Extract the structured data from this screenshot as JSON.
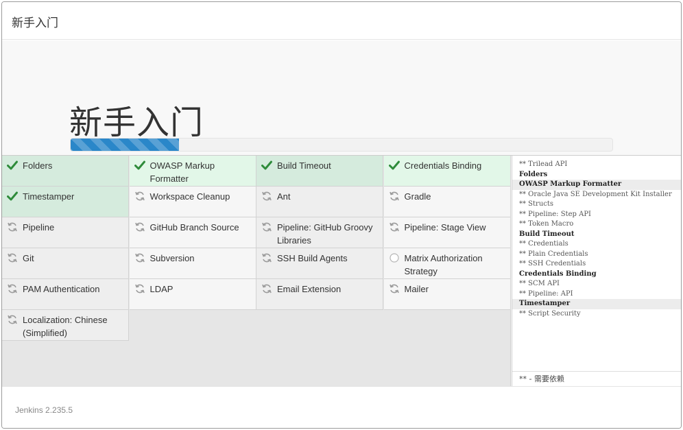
{
  "header": {
    "title": "新手入门"
  },
  "jumbotron": {
    "title": "新手入门",
    "progress_fraction": 0.2
  },
  "plugins": [
    {
      "name": "Folders",
      "status": "success"
    },
    {
      "name": "OWASP Markup Formatter",
      "status": "success"
    },
    {
      "name": "Build Timeout",
      "status": "success"
    },
    {
      "name": "Credentials Binding",
      "status": "success"
    },
    {
      "name": "Timestamper",
      "status": "success"
    },
    {
      "name": "Workspace Cleanup",
      "status": "pending"
    },
    {
      "name": "Ant",
      "status": "pending"
    },
    {
      "name": "Gradle",
      "status": "pending"
    },
    {
      "name": "Pipeline",
      "status": "pending"
    },
    {
      "name": "GitHub Branch Source",
      "status": "pending"
    },
    {
      "name": "Pipeline: GitHub Groovy Libraries",
      "status": "pending"
    },
    {
      "name": "Pipeline: Stage View",
      "status": "pending"
    },
    {
      "name": "Git",
      "status": "pending"
    },
    {
      "name": "Subversion",
      "status": "pending"
    },
    {
      "name": "SSH Build Agents",
      "status": "pending"
    },
    {
      "name": "Matrix Authorization Strategy",
      "status": "queued"
    },
    {
      "name": "PAM Authentication",
      "status": "pending"
    },
    {
      "name": "LDAP",
      "status": "pending"
    },
    {
      "name": "Email Extension",
      "status": "pending"
    },
    {
      "name": "Mailer",
      "status": "pending"
    },
    {
      "name": "Localization: Chinese (Simplified)",
      "status": "pending"
    }
  ],
  "log": {
    "lines": [
      {
        "text": "** Trilead API",
        "kind": "dep"
      },
      {
        "text": "Folders",
        "kind": "plugin"
      },
      {
        "text": "OWASP Markup Formatter",
        "kind": "plugin",
        "highlight": true
      },
      {
        "text": "** Oracle Java SE Development Kit Installer",
        "kind": "dep"
      },
      {
        "text": "** Structs",
        "kind": "dep"
      },
      {
        "text": "** Pipeline: Step API",
        "kind": "dep"
      },
      {
        "text": "** Token Macro",
        "kind": "dep"
      },
      {
        "text": "Build Timeout",
        "kind": "plugin"
      },
      {
        "text": "** Credentials",
        "kind": "dep"
      },
      {
        "text": "** Plain Credentials",
        "kind": "dep"
      },
      {
        "text": "** SSH Credentials",
        "kind": "dep"
      },
      {
        "text": "Credentials Binding",
        "kind": "plugin"
      },
      {
        "text": "** SCM API",
        "kind": "dep"
      },
      {
        "text": "** Pipeline: API",
        "kind": "dep"
      },
      {
        "text": "Timestamper",
        "kind": "plugin",
        "highlight": true
      },
      {
        "text": "** Script Security",
        "kind": "dep"
      }
    ],
    "footer": "** - 需要依赖"
  },
  "footer": {
    "version": "Jenkins 2.235.5"
  },
  "icons": {
    "success": "check-icon",
    "pending": "refresh-icon",
    "queued": "circle-icon"
  },
  "colors": {
    "success_green": "#2e8b3a",
    "progress_blue": "#2a87c9"
  }
}
